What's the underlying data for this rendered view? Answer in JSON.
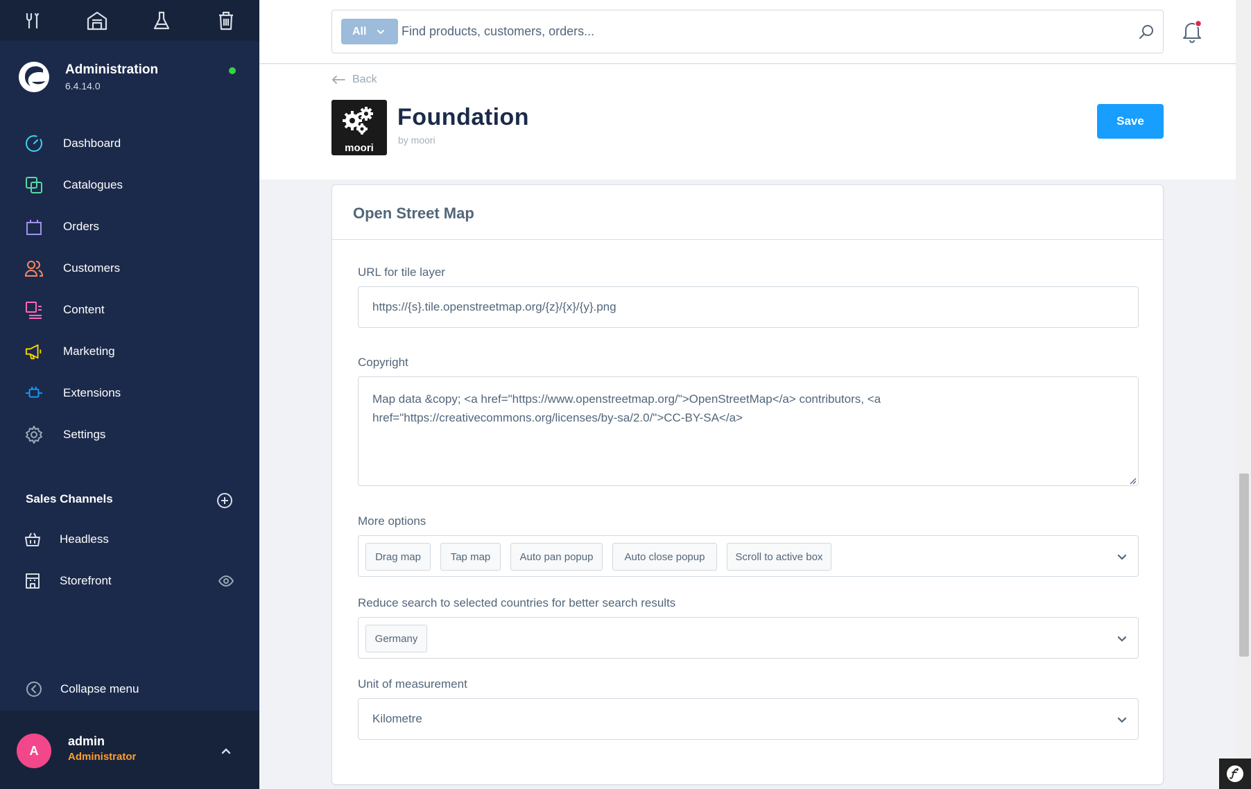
{
  "sidebar": {
    "brand_title": "Administration",
    "brand_version": "6.4.14.0",
    "nav": [
      {
        "label": "Dashboard",
        "icon": "dashboard-icon",
        "color": "#3ed2f8"
      },
      {
        "label": "Catalogues",
        "icon": "catalogues-icon",
        "color": "#57d9a3"
      },
      {
        "label": "Orders",
        "icon": "orders-icon",
        "color": "#a092f0"
      },
      {
        "label": "Customers",
        "icon": "customers-icon",
        "color": "#f88962"
      },
      {
        "label": "Content",
        "icon": "content-icon",
        "color": "#ff68b4"
      },
      {
        "label": "Marketing",
        "icon": "marketing-icon",
        "color": "#ffd700"
      },
      {
        "label": "Extensions",
        "icon": "extensions-icon",
        "color": "#189eff"
      },
      {
        "label": "Settings",
        "icon": "settings-icon",
        "color": "#9aa8b5"
      }
    ],
    "sales_channels_title": "Sales Channels",
    "channels": [
      {
        "label": "Headless",
        "icon": "basket-icon"
      },
      {
        "label": "Storefront",
        "icon": "storefront-icon"
      }
    ],
    "collapse_label": "Collapse menu",
    "user": {
      "initial": "A",
      "name": "admin",
      "role": "Administrator"
    }
  },
  "header": {
    "search_type": "All",
    "search_placeholder": "Find products, customers, orders..."
  },
  "page": {
    "back_label": "Back",
    "app_logo_text": "moori",
    "app_title": "Foundation",
    "app_author": "by moori",
    "save_label": "Save"
  },
  "card": {
    "title": "Open Street Map",
    "url_label": "URL for tile layer",
    "url_value": "https://{s}.tile.openstreetmap.org/{z}/{x}/{y}.png",
    "copyright_label": "Copyright",
    "copyright_value": "Map data &copy; <a href=\"https://www.openstreetmap.org/\">OpenStreetMap</a> contributors, <a href=\"https://creativecommons.org/licenses/by-sa/2.0/\">CC-BY-SA</a>",
    "options_label": "More options",
    "options": [
      "Drag map",
      "Tap map",
      "Auto pan popup",
      "Auto close popup",
      "Scroll to active box"
    ],
    "countries_label": "Reduce search to selected countries for better search results",
    "countries": [
      "Germany"
    ],
    "unit_label": "Unit of measurement",
    "unit_value": "Kilometre"
  },
  "colors": {
    "sidebar_bg": "#1b2a4a",
    "accent": "#189eff",
    "status_online": "#37d046",
    "avatar": "#f2488b",
    "role": "#ff9e2c"
  }
}
